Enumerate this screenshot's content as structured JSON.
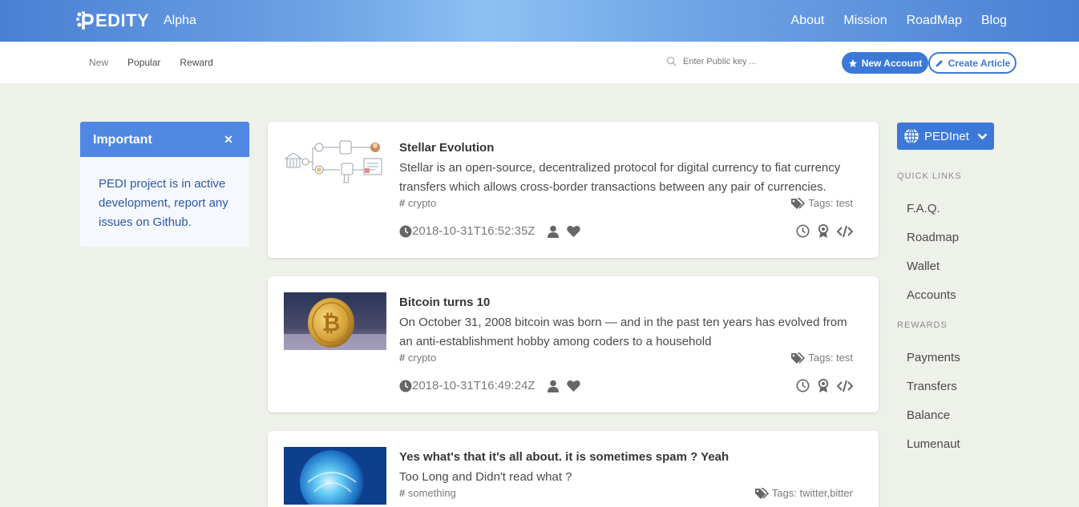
{
  "header": {
    "brand": "EDITY",
    "alpha": "Alpha",
    "nav": [
      "About",
      "Mission",
      "RoadMap",
      "Blog"
    ]
  },
  "subbar": {
    "tabs": [
      "New",
      "Popular",
      "Reward"
    ],
    "search_placeholder": "Enter Public key ...",
    "new_account": "New Account",
    "create_article": "Create Article"
  },
  "message": {
    "title": "Important",
    "body": "PEDI project is in active development, report any issues on Github."
  },
  "articles": [
    {
      "title": "Stellar Evolution",
      "description": "Stellar is an open-source, decentralized protocol for digital currency to fiat currency transfers which allows cross-border transactions between any pair of currencies.",
      "category": "crypto",
      "tags": "Tags: test",
      "timestamp": "2018-10-31T16:52:35Z"
    },
    {
      "title": "Bitcoin turns 10",
      "description": "On October 31, 2008 bitcoin was born — and in the past ten years has evolved from an anti-establishment hobby among coders to a household",
      "category": "crypto",
      "tags": "Tags: test",
      "timestamp": "2018-10-31T16:49:24Z"
    },
    {
      "title": "Yes what's that it's all about. it is sometimes spam ? Yeah",
      "description": "Too Long and Didn't read what ?",
      "category": "something",
      "tags": "Tags: twitter,bitter"
    }
  ],
  "sidebar": {
    "network": "PEDInet",
    "quick_links_label": "QUICK LINKS",
    "quick_links": [
      "F.A.Q.",
      "Roadmap",
      "Wallet",
      "Accounts"
    ],
    "rewards_label": "REWARDS",
    "rewards": [
      "Payments",
      "Transfers",
      "Balance",
      "Lumenaut"
    ]
  },
  "colors": {
    "primary": "#3b78d8",
    "message_header": "#4f87e3",
    "background": "#eef0ea"
  }
}
